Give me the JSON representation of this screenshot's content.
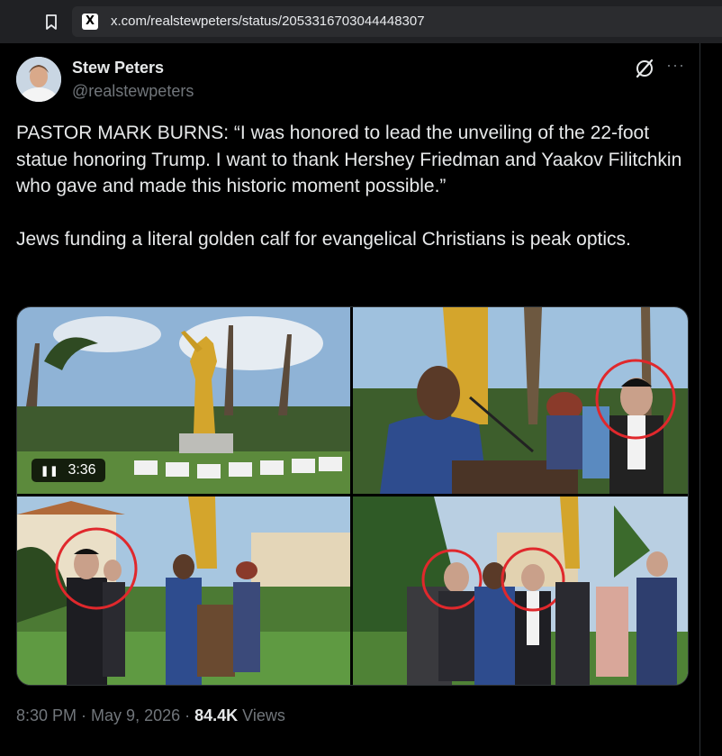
{
  "browser": {
    "url": "x.com/realstewpeters/status/2053316703044448307",
    "site_icon": "x-logo-icon",
    "bookmark_icon": "bookmark-icon"
  },
  "tweet": {
    "author_name": "Stew Peters",
    "author_handle": "@realstewpeters",
    "text": "PASTOR MARK BURNS: “I was honored to lead the unveiling of the 22-foot statue honoring Trump. I want to thank Hershey Friedman and Yaakov Filitchkin who gave and made this historic moment possible.”\n\nJews funding a literal golden calf for evangelical Christians is peak optics.",
    "video_duration": "3:36",
    "time": "8:30 PM",
    "sep1": " · ",
    "date": "May 9, 2026",
    "sep2": " · ",
    "views_count": "84.4K",
    "views_label": " Views"
  },
  "colors": {
    "background": "#000000",
    "text": "#e7e9ea",
    "secondary": "#71767b",
    "annotation_circle": "#e0282c",
    "statue_gold": "#d4a52c"
  }
}
